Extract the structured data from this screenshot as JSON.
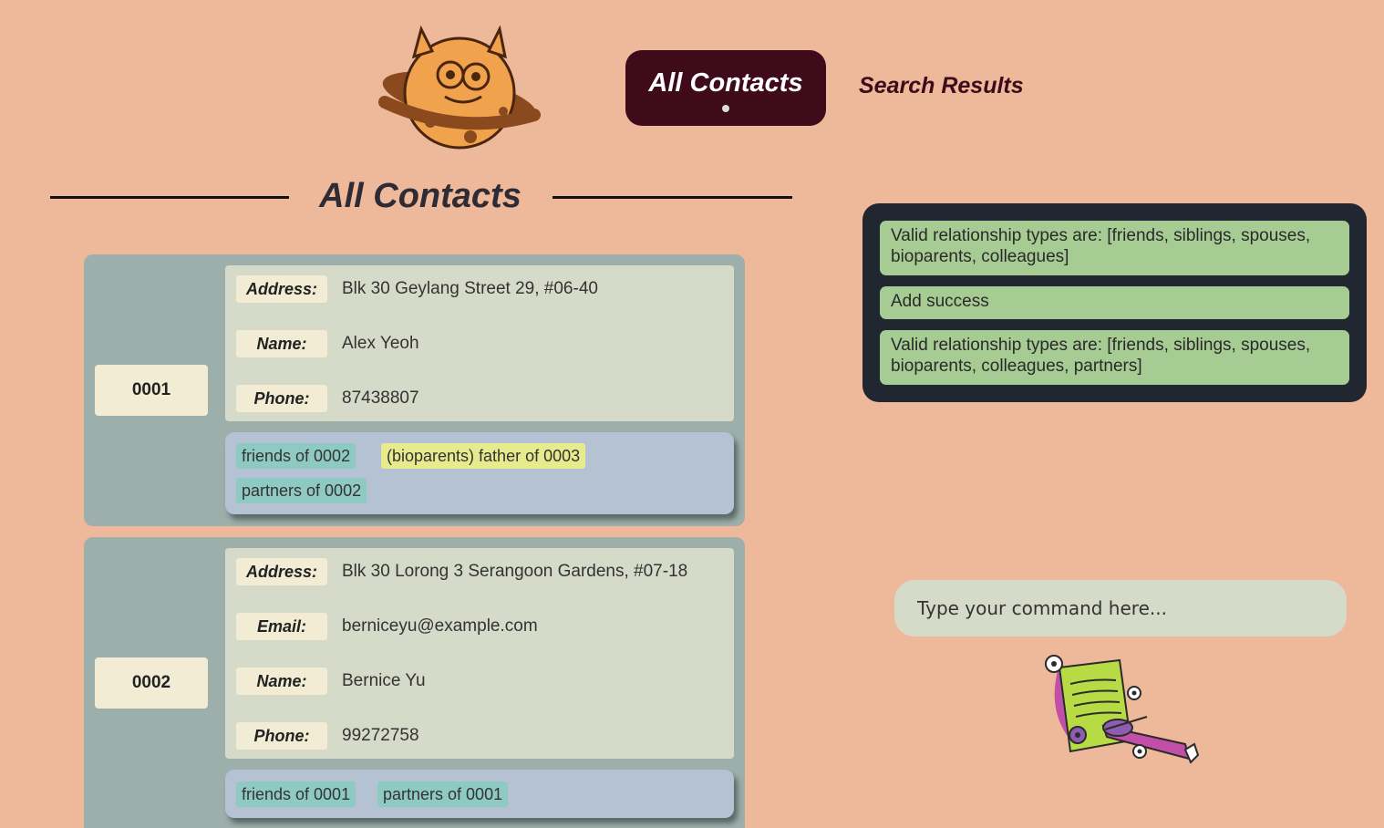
{
  "header": {
    "tabs": [
      {
        "label": "All Contacts",
        "active": true
      },
      {
        "label": "Search Results",
        "active": false
      }
    ]
  },
  "section": {
    "title": "All Contacts"
  },
  "contacts": [
    {
      "id": "0001",
      "fields": [
        {
          "label": "Address:",
          "value": "Blk 30 Geylang Street 29, #06-40"
        },
        {
          "label": "Name:",
          "value": "Alex Yeoh"
        },
        {
          "label": "Phone:",
          "value": "87438807"
        }
      ],
      "relationships": [
        {
          "text": "friends of 0002",
          "color": "#8ECAC2"
        },
        {
          "text": "(bioparents) father of 0003",
          "color": "#E7EB8E"
        },
        {
          "text": "partners of 0002",
          "color": "#8ECAC2"
        }
      ]
    },
    {
      "id": "0002",
      "fields": [
        {
          "label": "Address:",
          "value": "Blk 30 Lorong 3 Serangoon Gardens, #07-18"
        },
        {
          "label": "Email:",
          "value": "berniceyu@example.com"
        },
        {
          "label": "Name:",
          "value": "Bernice Yu"
        },
        {
          "label": "Phone:",
          "value": "99272758"
        }
      ],
      "relationships": [
        {
          "text": "friends of 0001",
          "color": "#8ECAC2"
        },
        {
          "text": "partners of 0001",
          "color": "#8ECAC2"
        }
      ]
    }
  ],
  "results": [
    "Valid relationship types are: [friends, siblings, spouses, bioparents, colleagues]",
    "Add success",
    "Valid relationship types are: [friends, siblings, spouses, bioparents, colleagues, partners]"
  ],
  "command": {
    "placeholder": "Type your command here..."
  },
  "icons": {
    "logo": "planet-monster-icon",
    "mascot": "monster-writing-icon"
  },
  "colors": {
    "background": "#EDB99A",
    "tab_active": "#3F0A19",
    "panel": "#212730",
    "message": "#A6CC94"
  }
}
